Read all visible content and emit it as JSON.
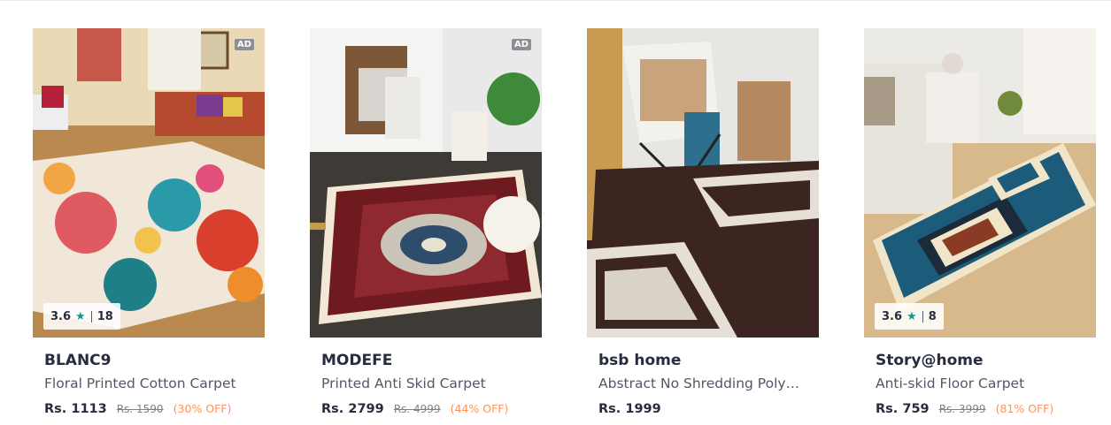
{
  "products": [
    {
      "brand": "BLANC9",
      "title": "Floral Printed Cotton Carpet",
      "price": "Rs. 1113",
      "mrp": "Rs. 1590",
      "discount": "(30% OFF)",
      "ad": "AD",
      "rating": "3.6",
      "rating_count": "18"
    },
    {
      "brand": "MODEFE",
      "title": "Printed Anti Skid Carpet",
      "price": "Rs. 2799",
      "mrp": "Rs. 4999",
      "discount": "(44% OFF)",
      "ad": "AD"
    },
    {
      "brand": "bsb home",
      "title": "Abstract No Shredding Polyester Carpet",
      "price": "Rs. 1999"
    },
    {
      "brand": "Story@home",
      "title": "Anti-skid Floor Carpet",
      "price": "Rs. 759",
      "mrp": "Rs. 3999",
      "discount": "(81% OFF)",
      "rating": "3.6",
      "rating_count": "8"
    }
  ],
  "icons": {
    "rating": "star-icon"
  },
  "colors": {
    "star": "#14958f",
    "discount": "#ff905a",
    "brand_text": "#282c3f",
    "title_text": "#535766"
  }
}
